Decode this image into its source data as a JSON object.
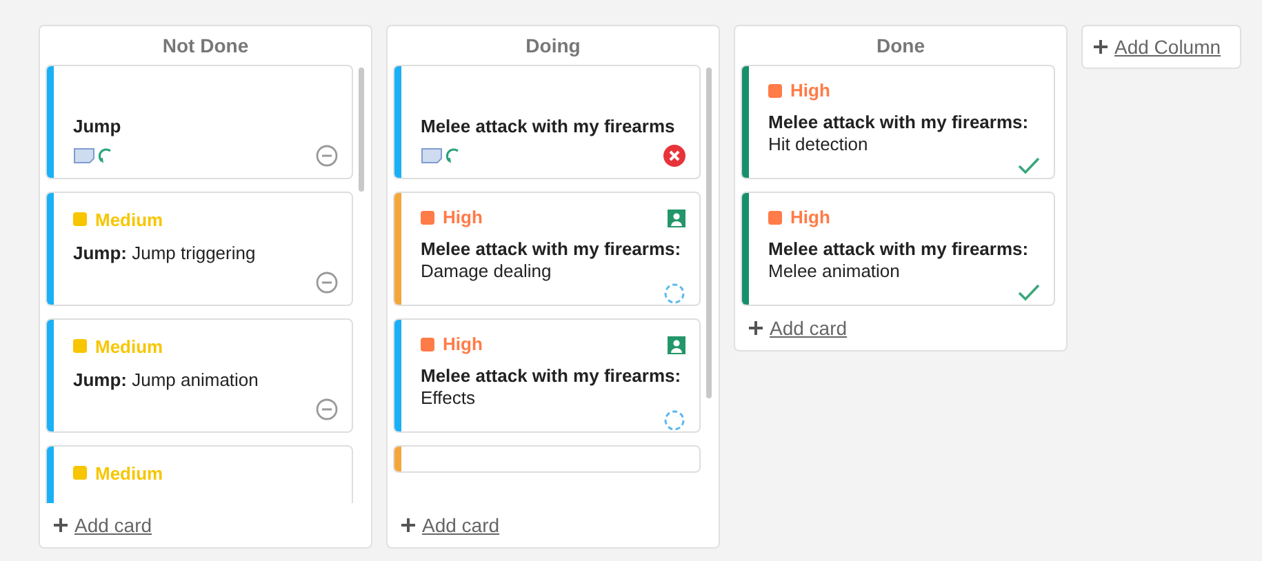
{
  "columns": [
    {
      "title": "Not Done",
      "scrollable": true,
      "add_card": "Add card",
      "cards": [
        {
          "kind": "story",
          "color": "#1ab0f5",
          "text": "Jump",
          "status": {
            "kind": "minus"
          }
        },
        {
          "kind": "task",
          "color": "#1ab0f5",
          "priority": {
            "label": "Medium",
            "color": "#f7c600"
          },
          "assigned": false,
          "text": "**Jump:** Jump triggering",
          "status": {
            "kind": "minus"
          }
        },
        {
          "kind": "task",
          "color": "#1ab0f5",
          "priority": {
            "label": "Medium",
            "color": "#f7c600"
          },
          "assigned": false,
          "text": "**Jump:** Jump animation",
          "status": {
            "kind": "minus"
          }
        },
        {
          "kind": "task",
          "color": "#1ab0f5",
          "priority": {
            "label": "Medium",
            "color": "#f7c600"
          },
          "assigned": false
        }
      ]
    },
    {
      "title": "Doing",
      "scrollable": true,
      "add_card": "Add card",
      "cards": [
        {
          "kind": "story",
          "color": "#1ab0f5",
          "text": "Melee attack with my firearms",
          "status": {
            "kind": "error"
          }
        },
        {
          "kind": "task",
          "color": "#f4a63a",
          "priority": {
            "label": "High",
            "color": "#ff7b47"
          },
          "assigned": true,
          "text": "**Melee attack with my firearms:** Damage dealing",
          "status": {
            "kind": "progress"
          }
        },
        {
          "kind": "task",
          "color": "#1ab0f5",
          "priority": {
            "label": "High",
            "color": "#ff7b47"
          },
          "assigned": true,
          "text": "**Melee attack with my firearms:** Effects",
          "status": {
            "kind": "progress"
          }
        },
        {
          "kind": "stub",
          "color": "#f4a63a"
        }
      ]
    },
    {
      "title": "Done",
      "scrollable": false,
      "add_card": "Add card",
      "cards": [
        {
          "kind": "task",
          "color": "#16906a",
          "priority": {
            "label": "High",
            "color": "#ff7b47"
          },
          "assigned": false,
          "text": "**Melee attack with my firearms:** Hit detection",
          "status": {
            "kind": "done"
          }
        },
        {
          "kind": "task",
          "color": "#16906a",
          "priority": {
            "label": "High",
            "color": "#ff7b47"
          },
          "assigned": false,
          "text": "**Melee attack with my firearms:** Melee animation",
          "status": {
            "kind": "done"
          }
        }
      ]
    }
  ],
  "add_column": "Add Column"
}
